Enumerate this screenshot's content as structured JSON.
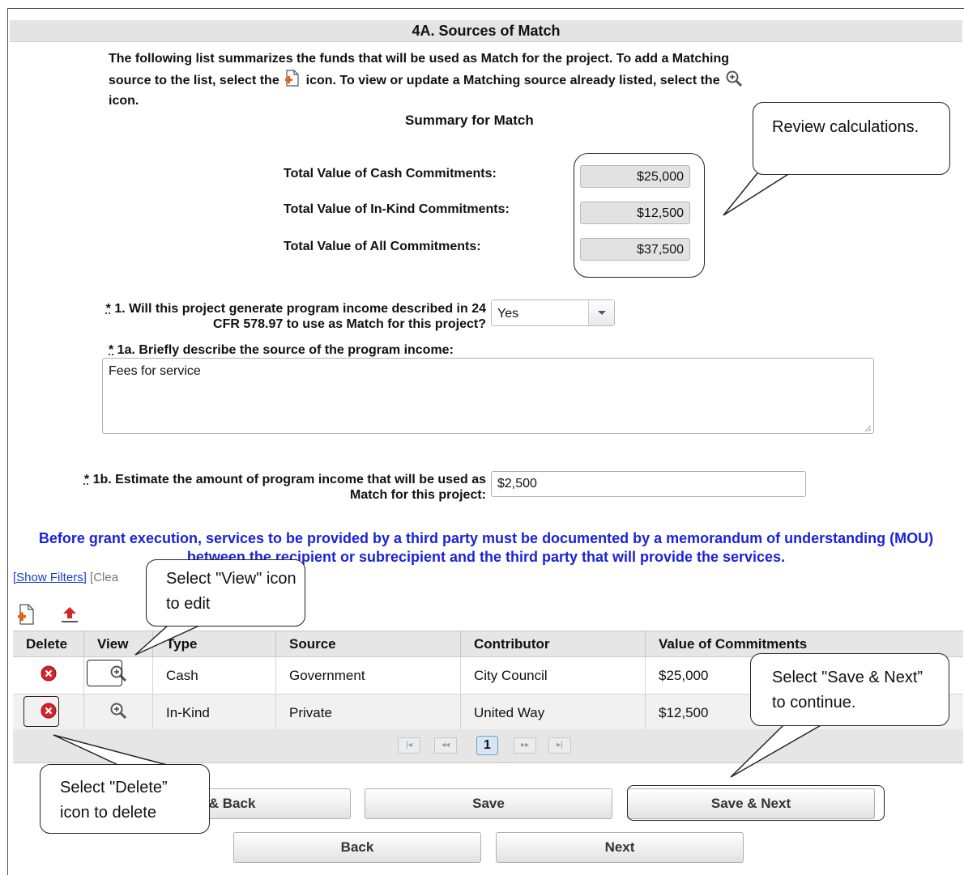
{
  "header": {
    "title": "4A. Sources of Match"
  },
  "intro": {
    "line1": "The following list summarizes the funds that will be used as Match for the project. To add a Matching",
    "line2a": "source to the list, select the",
    "line2b": "icon. To view or update a Matching source already listed, select the",
    "line3": "icon."
  },
  "summary": {
    "title": "Summary for Match",
    "rows": [
      {
        "label": "Total Value of Cash Commitments:",
        "value": "$25,000"
      },
      {
        "label": "Total Value of In-Kind Commitments:",
        "value": "$12,500"
      },
      {
        "label": "Total Value of All Commitments:",
        "value": "$37,500"
      }
    ]
  },
  "q1": {
    "marker": "*",
    "line1": " 1. Will this project generate program income described in 24",
    "line2": "CFR 578.97 to use as Match for this project?",
    "value": "Yes"
  },
  "q1a": {
    "marker": "*",
    "label": " 1a. Briefly describe the source of the program income:",
    "value": "Fees for service"
  },
  "q1b": {
    "marker": "*",
    "line1": " 1b. Estimate the amount of program income that will be used as",
    "line2": "Match for this project:",
    "value": "$2,500"
  },
  "notice": "Before grant execution, services to be provided by a third party must be documented by a memorandum of understanding (MOU) between the recipient or subrecipient and the third party that will provide the services.",
  "filters": {
    "show": "[Show Filters]",
    "clear": "[Clea"
  },
  "table": {
    "columns": [
      "Delete",
      "View",
      "Type",
      "Source",
      "Contributor",
      "Value of Commitments"
    ],
    "rows": [
      {
        "type": "Cash",
        "source": "Government",
        "contributor": "City Council",
        "value": "$25,000"
      },
      {
        "type": "In-Kind",
        "source": "Private",
        "contributor": "United Way",
        "value": "$12,500"
      }
    ]
  },
  "pager": {
    "current": "1",
    "first": "|◂",
    "prev": "◂◂",
    "next": "▸▸",
    "last": "▸|"
  },
  "buttons": {
    "save_back": "e & Back",
    "save": "Save",
    "save_next": "Save & Next",
    "back": "Back",
    "next": "Next"
  },
  "callouts": {
    "review": "Review calculations.",
    "view": "Select \"View\" icon to edit",
    "save_next": "Select \"Save & Next” to continue.",
    "delete": "Select \"Delete” icon to delete"
  },
  "icons": {
    "add": "add-document-icon",
    "view": "magnifier-plus-icon",
    "delete": "red-x-circle-icon",
    "upload": "upload-icon"
  },
  "colors": {
    "notice": "#1a23d8",
    "delete": "#d3262c",
    "header_bg": "#e4e4e4"
  }
}
